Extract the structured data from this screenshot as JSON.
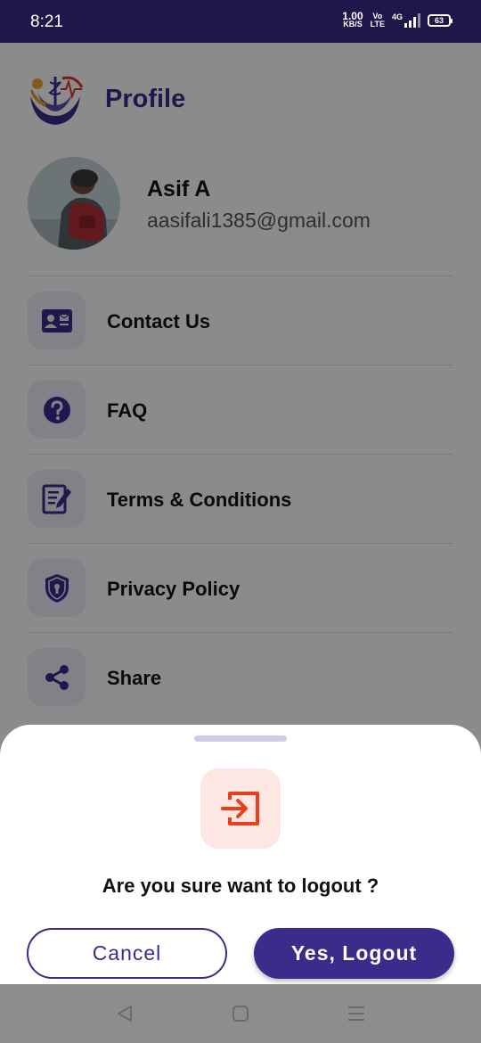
{
  "status_bar": {
    "time": "8:21",
    "net_speed_value": "1.00",
    "net_speed_unit": "KB/S",
    "volte_top": "Vo",
    "volte_bottom": "LTE",
    "network_type": "4G",
    "battery": "63"
  },
  "header": {
    "title": "Profile"
  },
  "profile": {
    "name": "Asif A",
    "email": "aasifali1385@gmail.com"
  },
  "menu": {
    "items": [
      {
        "label": "Contact Us",
        "icon": "contact-card-icon"
      },
      {
        "label": "FAQ",
        "icon": "question-icon"
      },
      {
        "label": "Terms & Conditions",
        "icon": "document-edit-icon"
      },
      {
        "label": "Privacy Policy",
        "icon": "shield-lock-icon"
      },
      {
        "label": "Share",
        "icon": "share-icon"
      }
    ]
  },
  "logout_sheet": {
    "question": "Are you sure want to logout ?",
    "cancel_label": "Cancel",
    "confirm_label": "Yes, Logout"
  },
  "colors": {
    "primary": "#3b2b8a",
    "danger": "#e8401c",
    "status_bar": "#1e184a"
  }
}
